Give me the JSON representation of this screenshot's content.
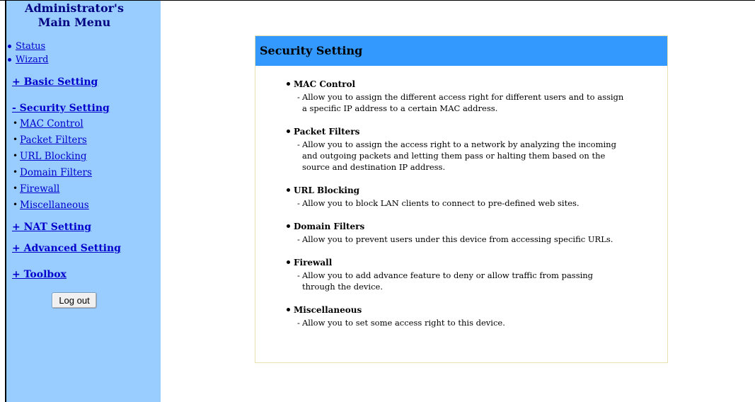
{
  "sidebar": {
    "title": "Administrator's Main Menu",
    "top_items": [
      {
        "label": "Status"
      },
      {
        "label": "Wizard"
      }
    ],
    "sections": {
      "basic": "+ Basic Setting",
      "security": "- Security Setting",
      "nat": "+ NAT Setting",
      "advanced": "+ Advanced Setting",
      "toolbox": "+ Toolbox"
    },
    "security_items": [
      {
        "label": "MAC Control"
      },
      {
        "label": "Packet Filters"
      },
      {
        "label": "URL Blocking"
      },
      {
        "label": "Domain Filters"
      },
      {
        "label": "Firewall"
      },
      {
        "label": "Miscellaneous"
      }
    ],
    "logout_label": "Log out"
  },
  "panel": {
    "title": "Security Setting",
    "features": [
      {
        "title": "MAC Control",
        "desc": "Allow you to assign the different access right for different users and to assign a specific IP address to a certain MAC address."
      },
      {
        "title": "Packet Filters",
        "desc": "Allow you to assign the access right to a network by analyzing the incoming and outgoing packets and letting them pass or halting them based on the source and destination IP address."
      },
      {
        "title": "URL Blocking",
        "desc": "Allow you to block LAN clients to connect to pre-defined web sites."
      },
      {
        "title": "Domain Filters",
        "desc": "Allow you to prevent users under this device from accessing specific URLs."
      },
      {
        "title": "Firewall",
        "desc": "Allow you to add advance feature to deny or allow traffic from passing through the device."
      },
      {
        "title": "Miscellaneous",
        "desc": "Allow you to set some access right to this device."
      }
    ]
  },
  "colors": {
    "sidebar_bg": "#99ccff",
    "header_bg": "#3399ff",
    "link": "#0000cc",
    "title": "#000080"
  }
}
